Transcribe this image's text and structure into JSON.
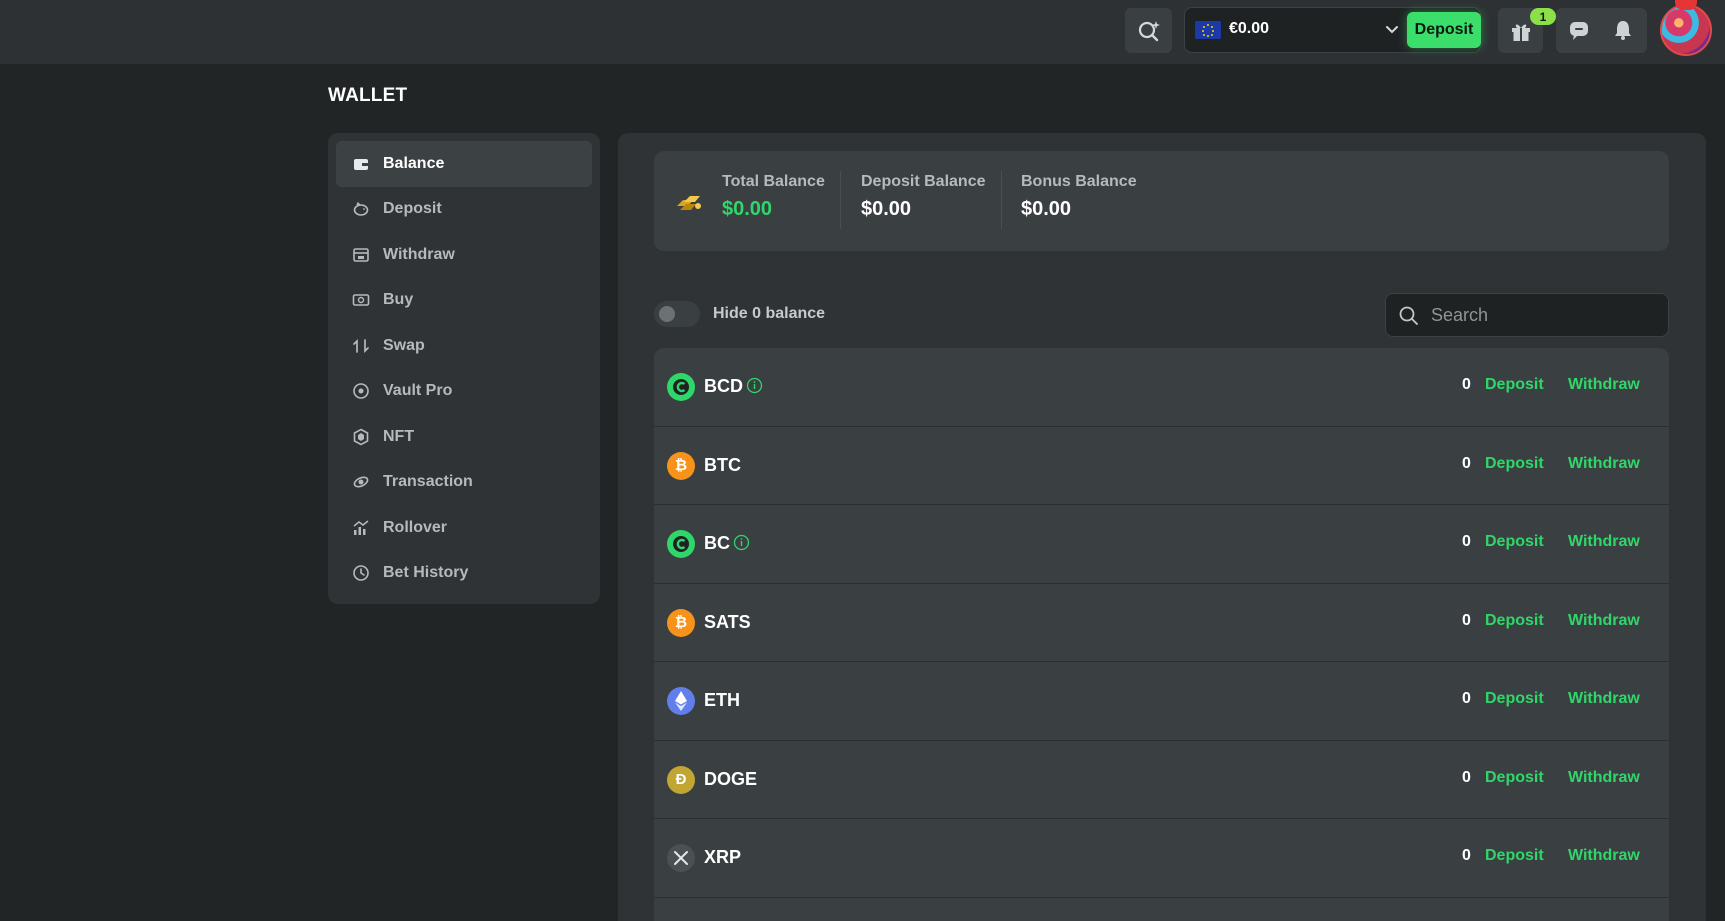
{
  "header": {
    "wallet_amount": "€0.00",
    "deposit_label": "Deposit",
    "gift_badge": "1"
  },
  "page": {
    "title": "WALLET"
  },
  "sidebar": {
    "items": [
      {
        "label": "Balance",
        "icon": "wallet-icon",
        "active": true
      },
      {
        "label": "Deposit",
        "icon": "piggy-bank-icon"
      },
      {
        "label": "Withdraw",
        "icon": "withdraw-icon"
      },
      {
        "label": "Buy",
        "icon": "cash-icon"
      },
      {
        "label": "Swap",
        "icon": "swap-icon"
      },
      {
        "label": "Vault Pro",
        "icon": "vault-icon"
      },
      {
        "label": "NFT",
        "icon": "nft-icon"
      },
      {
        "label": "Transaction",
        "icon": "transaction-icon"
      },
      {
        "label": "Rollover",
        "icon": "rollover-icon"
      },
      {
        "label": "Bet History",
        "icon": "clock-icon"
      }
    ]
  },
  "balances": {
    "total": {
      "label": "Total Balance",
      "value": "$0.00"
    },
    "deposit": {
      "label": "Deposit Balance",
      "value": "$0.00"
    },
    "bonus": {
      "label": "Bonus Balance",
      "value": "$0.00"
    }
  },
  "filters": {
    "hide_zero_label": "Hide 0 balance",
    "search_placeholder": "Search"
  },
  "coins": [
    {
      "symbol": "BCD",
      "amount": "0",
      "deposit": "Deposit",
      "withdraw": "Withdraw",
      "color": "#2fd76a",
      "info": true
    },
    {
      "symbol": "BTC",
      "amount": "0",
      "deposit": "Deposit",
      "withdraw": "Withdraw",
      "color": "#f7931a",
      "info": false
    },
    {
      "symbol": "BC",
      "amount": "0",
      "deposit": "Deposit",
      "withdraw": "Withdraw",
      "color": "#2fd76a",
      "info": true
    },
    {
      "symbol": "SATS",
      "amount": "0",
      "deposit": "Deposit",
      "withdraw": "Withdraw",
      "color": "#f7931a",
      "info": false
    },
    {
      "symbol": "ETH",
      "amount": "0",
      "deposit": "Deposit",
      "withdraw": "Withdraw",
      "color": "#627eea",
      "info": false
    },
    {
      "symbol": "DOGE",
      "amount": "0",
      "deposit": "Deposit",
      "withdraw": "Withdraw",
      "color": "#c2a633",
      "info": false
    },
    {
      "symbol": "XRP",
      "amount": "0",
      "deposit": "Deposit",
      "withdraw": "Withdraw",
      "color": "#4b5053",
      "info": false
    }
  ],
  "colors": {
    "accent": "#2fd76a",
    "cta": "#3bde6b",
    "background": "#222526",
    "panel": "#2f3335"
  }
}
